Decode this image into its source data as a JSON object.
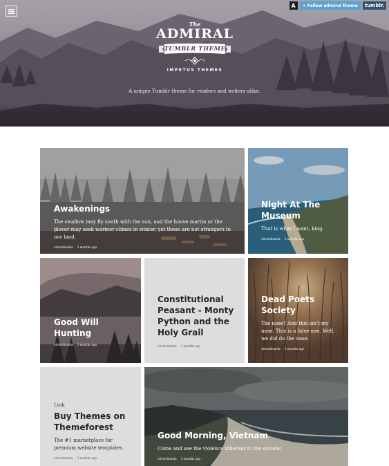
{
  "header": {
    "topbar": {
      "avatar_letter": "A",
      "follow_label": "Follow admiral theme",
      "follow_plus": "+",
      "tumblr_label": "tumblr."
    },
    "logo": {
      "the": "The",
      "name": "ADMIRAL",
      "ribbon": "TUMBLR THEME",
      "byline": "IMPETUS THEMES"
    },
    "tagline": "A unique Tumblr theme for readers and writers alike.",
    "menu_icon": "hamburger-icon"
  },
  "posts": [
    {
      "title": "Awakenings",
      "body": "The swallow may fly south with the sun, and the house martin or the plover may seek warmer climes in winter, yet these are not strangers to our land.",
      "author": "oliverdionela",
      "time": "3 months ago"
    },
    {
      "title": "Night At The Museum",
      "body": "That is what I want, king.",
      "author": "oliverdionela",
      "time": "3 months ago"
    },
    {
      "title": "Good Will Hunting",
      "author": "oliverdionela",
      "time": "3 months ago"
    },
    {
      "title": "Constitutional Peasant - Monty Python and the Holy Grail",
      "author": "oliverdionela",
      "time": "3 months ago"
    },
    {
      "title": "Dead Poets Society",
      "body": "The nose? And this isn't my nose. This is a false one. Well, we did do the nose.",
      "author": "oliverdionela",
      "time": "3 months ago"
    },
    {
      "kicker": "Link",
      "title": "Buy Themes on Themeforest",
      "body": "The #1 marketplace for premium website templates.",
      "author": "oliverdionela",
      "time": "3 months ago"
    },
    {
      "title": "Good Morning, Vietnam",
      "body": "Come and see the violence inherent in the system!",
      "author": "oliverdionela",
      "time": "3 months ago"
    }
  ],
  "colors": {
    "follow_button": "#5aa1d6",
    "tumblr_button": "#34526f",
    "grey_card": "#dddddd"
  }
}
